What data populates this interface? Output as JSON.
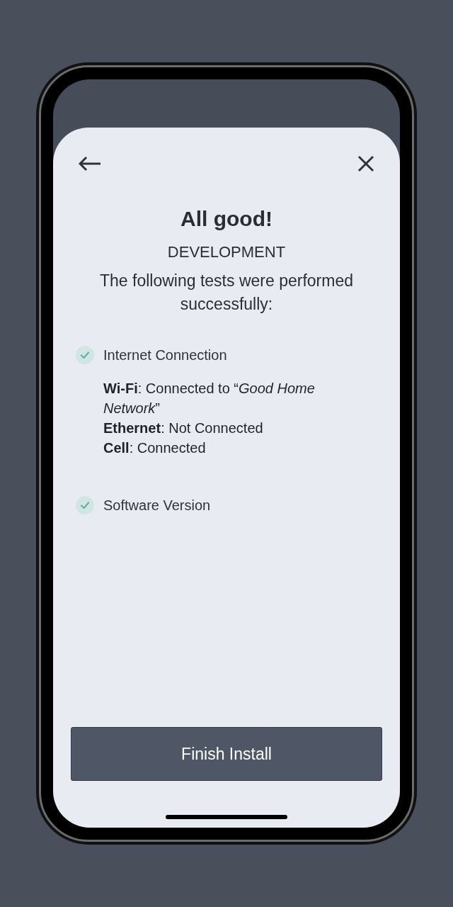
{
  "title": "All good!",
  "environment": "DEVELOPMENT",
  "intro": "The following tests were performed successfully:",
  "tests": [
    {
      "label": "Internet Connection",
      "passed": true,
      "details": [
        "**Wi-Fi**: Connected to “*Good Home Network*”",
        "**Ethernet**: Not Connected",
        "**Cell**: Connected"
      ]
    },
    {
      "label": "Software Version",
      "passed": true
    }
  ],
  "primary_button": "Finish Install"
}
